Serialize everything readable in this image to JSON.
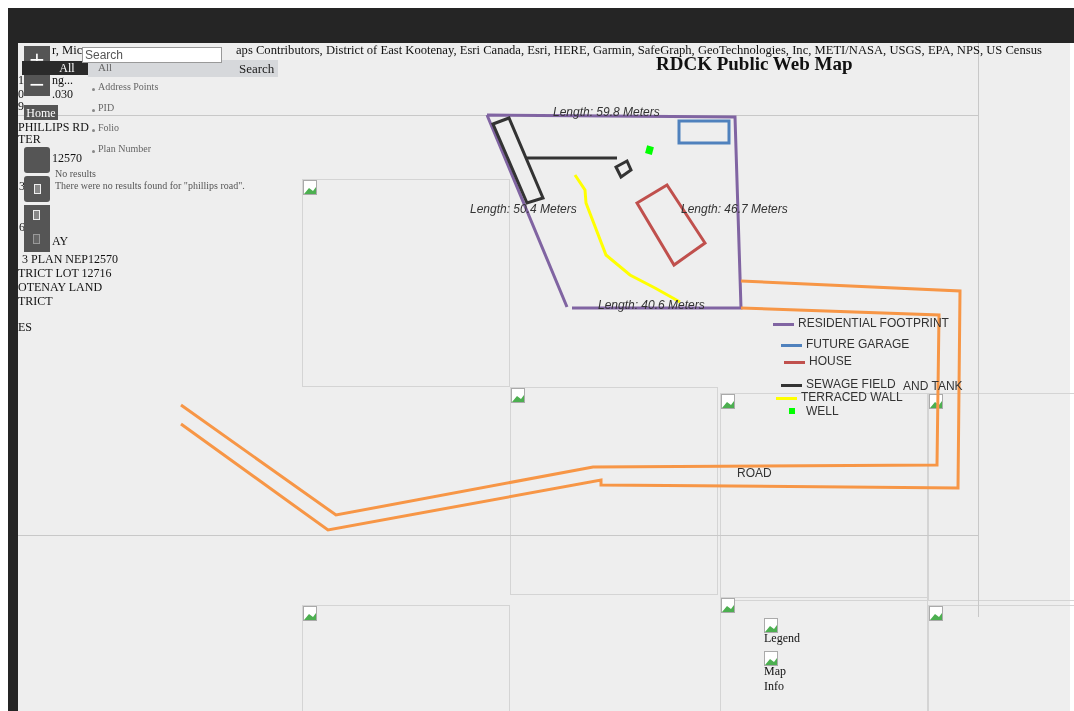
{
  "attribution": [
    "r, Mic",
    "aps Contributors, District of East Kootenay, Esri Canada, Esri, HERE, Garmin, SafeGraph, GeoTechnologies, Inc, METI/NASA, USGS, EPA, NPS, US Census"
  ],
  "title": "RDCK Public Web Map",
  "zoom_controls": {
    "zoom_in": "+",
    "zoom_out": "−",
    "home": "Home"
  },
  "search": {
    "placeholder": "Search",
    "scope_dropdown": "All",
    "scope_selected": "All",
    "button": "Search",
    "options": [
      "Address Points",
      "PID",
      "Folio",
      "Plan Number"
    ],
    "no_results": "No results",
    "message": "There were no results found for \"phillips road\"."
  },
  "property_panel": [
    "1",
    "ng...",
    "0",
    ".030",
    "9",
    "PHILLIPS RD",
    "TER",
    "12570",
    "3",
    "6",
    "AY",
    "3 PLAN NEP12570",
    "TRICT LOT 12716",
    "OTENAY LAND",
    "TRICT",
    "ES"
  ],
  "measurements": [
    "Length: 59.8 Meters",
    "Length: 50.4 Meters",
    "Length: 46.7 Meters",
    "Length: 40.6 Meters"
  ],
  "legend": [
    {
      "label": "RESIDENTIAL FOOTPRINT",
      "kind": "line",
      "color": "#8064a2"
    },
    {
      "label": "FUTURE GARAGE",
      "kind": "line",
      "color": "#4f81bd"
    },
    {
      "label": "HOUSE",
      "kind": "line",
      "color": "#c0504d"
    },
    {
      "label": "SEWAGE FIELD",
      "kind": "line",
      "color": "#333333"
    },
    {
      "label": "TERRACED WALL",
      "kind": "line",
      "color": "#ffff00"
    },
    {
      "label": "WELL",
      "kind": "point",
      "color": "#00ff00"
    }
  ],
  "legend_extra": "AND TANK",
  "road_label": "ROAD",
  "widgets": [
    "Legend",
    "Map Info"
  ]
}
